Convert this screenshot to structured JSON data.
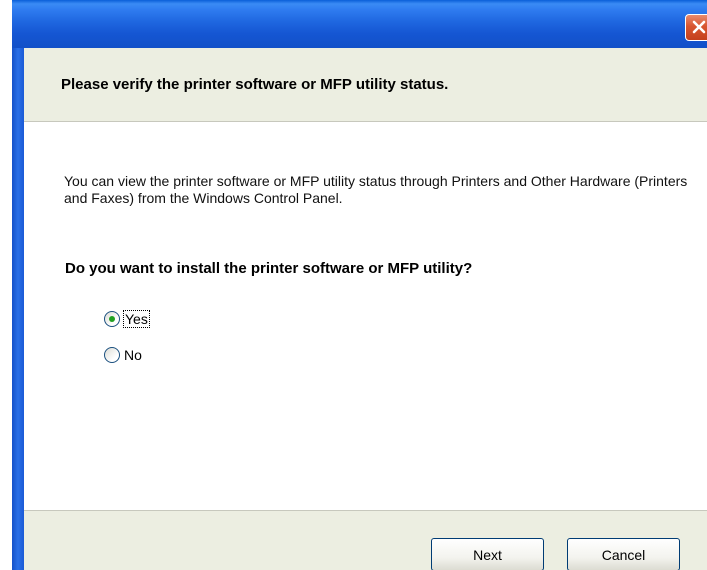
{
  "window": {
    "close_icon": "close-icon",
    "accent_color": "#1556d3",
    "close_color": "#d8552f"
  },
  "header": {
    "title": "Please verify the printer software or MFP utility status."
  },
  "body": {
    "info_text": "You can view the printer software or MFP utility status through Printers and Other Hardware (Printers and Faxes) from the Windows Control Panel.",
    "question": "Do you want to install the printer software or MFP utility?",
    "options": [
      {
        "label": "Yes",
        "selected": true
      },
      {
        "label": "No",
        "selected": false
      }
    ]
  },
  "footer": {
    "next_label": "Next",
    "cancel_label": "Cancel"
  }
}
